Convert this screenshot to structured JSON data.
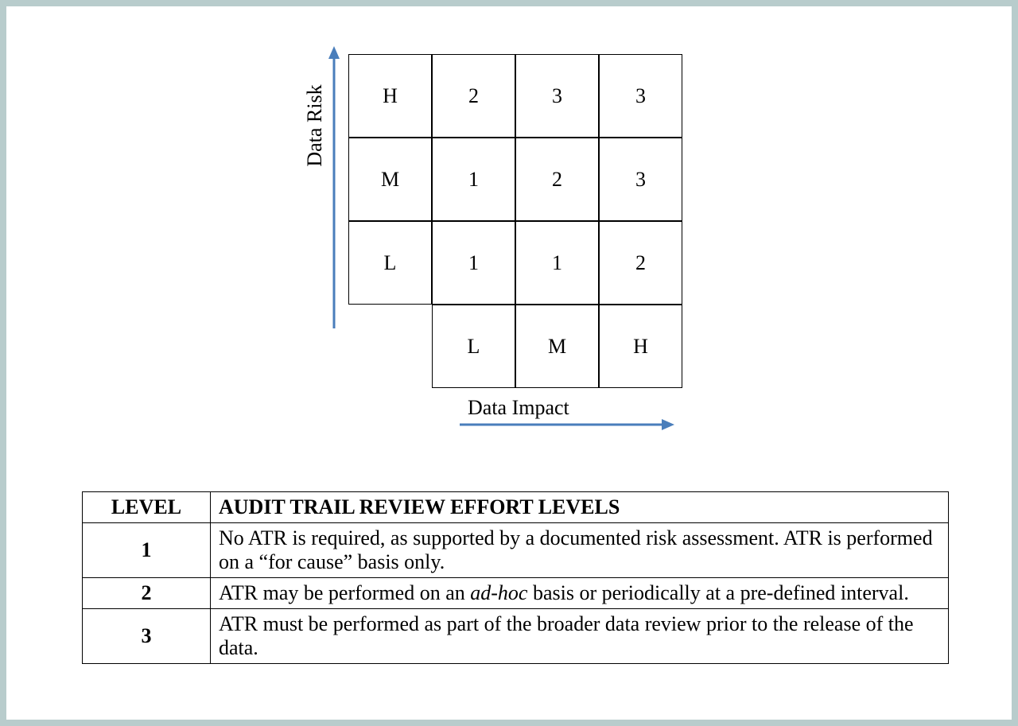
{
  "matrix": {
    "y_axis_label": "Data Risk",
    "x_axis_label": "Data Impact",
    "y_levels": [
      "H",
      "M",
      "L"
    ],
    "x_levels": [
      "L",
      "M",
      "H"
    ],
    "cells": {
      "H": {
        "L": "2",
        "M": "3",
        "H": "3"
      },
      "M": {
        "L": "1",
        "M": "2",
        "H": "3"
      },
      "L": {
        "L": "1",
        "M": "1",
        "H": "2"
      }
    },
    "arrow_color": "#4a7ebb"
  },
  "table": {
    "header": {
      "level": "LEVEL",
      "desc": "AUDIT TRAIL REVIEW EFFORT LEVELS"
    },
    "rows": [
      {
        "level": "1",
        "desc_plain": "No ATR is required, as supported by a documented risk assessment. ATR is performed on a “for cause” basis only."
      },
      {
        "level": "2",
        "desc_pre": "ATR may be performed on an ",
        "desc_italic": "ad-hoc",
        "desc_post": " basis or periodically at a pre-defined interval."
      },
      {
        "level": "3",
        "desc_plain": "ATR must be performed as part of the broader data review prior to the release of the data."
      }
    ]
  }
}
